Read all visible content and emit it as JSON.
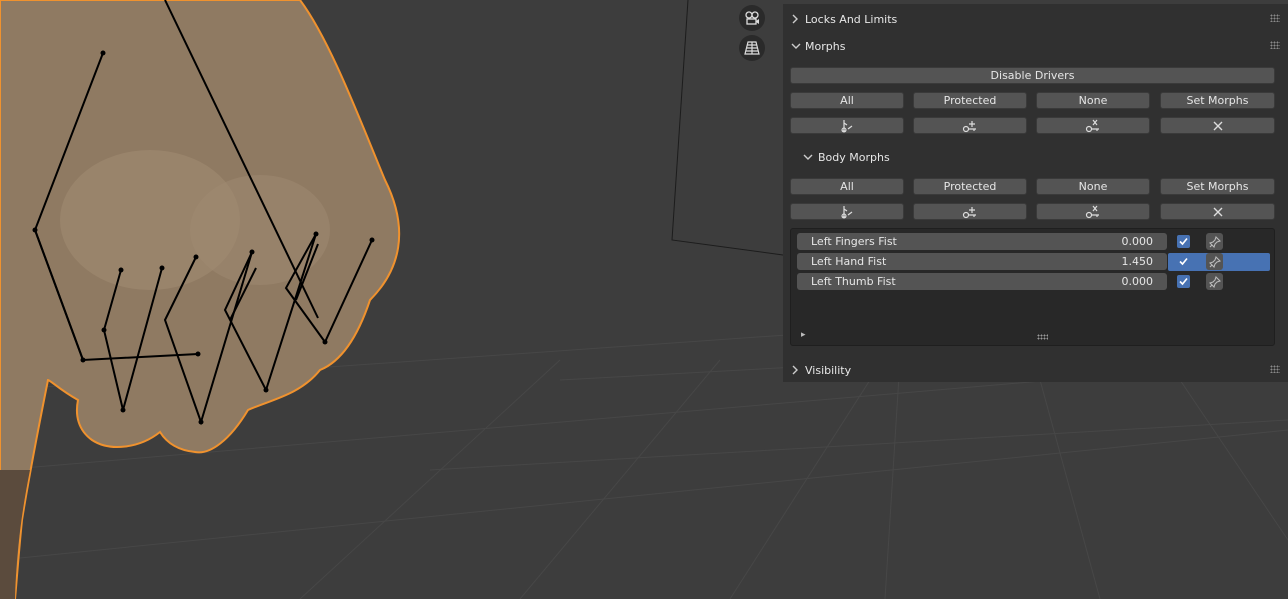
{
  "panels": {
    "locks": {
      "title": "Locks And Limits",
      "expanded": false
    },
    "morphs": {
      "title": "Morphs",
      "expanded": true
    },
    "visibility": {
      "title": "Visibility",
      "expanded": false
    }
  },
  "morphs": {
    "disable_drivers": "Disable Drivers",
    "filter_buttons": [
      "All",
      "Protected",
      "None",
      "Set Morphs"
    ],
    "action_icons": [
      "pose-key-icon",
      "add-key-icon",
      "remove-key-icon",
      "clear-icon"
    ]
  },
  "body_morphs": {
    "title": "Body Morphs",
    "filter_buttons": [
      "All",
      "Protected",
      "None",
      "Set Morphs"
    ],
    "items": [
      {
        "name": "Left Fingers Fist",
        "value": "0.000",
        "checked": true
      },
      {
        "name": "Left Hand Fist",
        "value": "1.450",
        "checked": true,
        "selected": true
      },
      {
        "name": "Left Thumb Fist",
        "value": "0.000",
        "checked": true
      }
    ],
    "expand_glyph": "▸"
  },
  "colors": {
    "accent": "#4772b3",
    "selection_outline": "#f0922e",
    "panel_bg": "#303030",
    "viewport_bg": "#3d3d3d"
  }
}
